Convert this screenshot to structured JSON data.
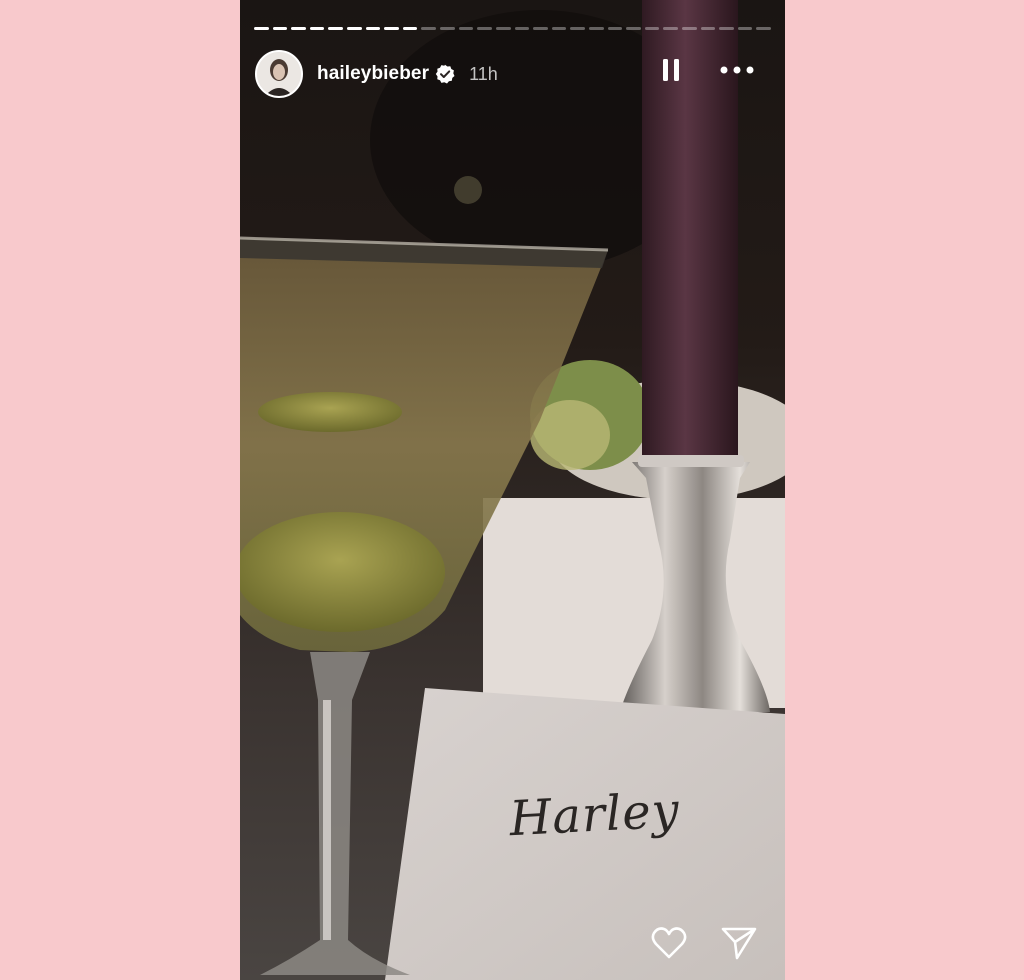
{
  "story": {
    "username": "haileybieber",
    "time_ago": "11h",
    "verified": true,
    "progress_segments": 28,
    "progress_completed": 9
  },
  "icons": {
    "verified": "verified-badge-icon",
    "pause": "pause-icon",
    "more": "more-options-icon",
    "like": "heart-icon",
    "share": "send-icon"
  },
  "photo": {
    "place_card_text": "Harley"
  },
  "colors": {
    "page_background": "#f8c9cc",
    "text": "#ffffff",
    "candle": "#4a2a34"
  }
}
